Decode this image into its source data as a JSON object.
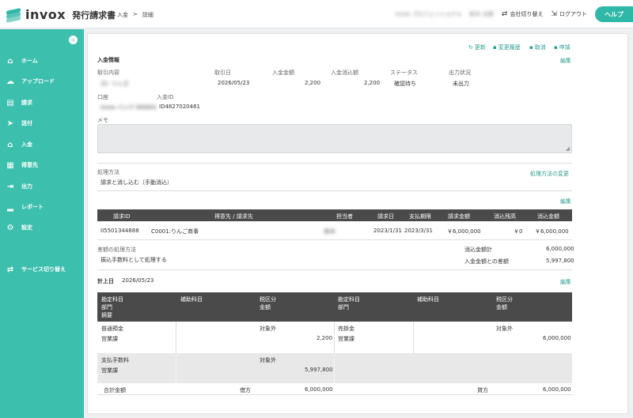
{
  "header": {
    "logo_text": "invox",
    "logo_sub": "発行請求書",
    "breadcrumb": [
      "入金",
      ">",
      "詳細"
    ],
    "company": "invox プロフェッショナル",
    "user": "鈴木 太郎",
    "switch_company": "会社切り替え",
    "logout": "ログアウト",
    "help": "ヘルプ"
  },
  "sidebar": {
    "items": [
      {
        "label": "ホーム",
        "icon": "home-icon",
        "glyph": "⌂"
      },
      {
        "label": "アップロード",
        "icon": "cloud-upload-icon",
        "glyph": "☁"
      },
      {
        "label": "請求",
        "icon": "document-icon",
        "glyph": "▤"
      },
      {
        "label": "送付",
        "icon": "send-icon",
        "glyph": "➤"
      },
      {
        "label": "入金",
        "icon": "bank-icon",
        "glyph": "⌂"
      },
      {
        "label": "得意先",
        "icon": "building-icon",
        "glyph": "▦"
      },
      {
        "label": "出力",
        "icon": "export-icon",
        "glyph": "⇥"
      },
      {
        "label": "レポート",
        "icon": "chart-icon",
        "glyph": "▂"
      },
      {
        "label": "設定",
        "icon": "gear-icon",
        "glyph": "⚙"
      }
    ],
    "service_switch": "サービス切り替え"
  },
  "actions": {
    "refresh": "更新",
    "history": "変更履歴",
    "cancel": "取消",
    "apply": "申請",
    "edit": "編集"
  },
  "deposit": {
    "section_title": "入金情報",
    "labels": {
      "content": "取引内容",
      "date": "取引日",
      "amount": "入金金額",
      "cleared": "入金消込額",
      "status": "ステータス",
      "output": "出力状況",
      "account": "口座",
      "deposit_id": "入金ID",
      "memo": "メモ"
    },
    "values": {
      "content": "カ）リンゴ",
      "date": "2026/05/23",
      "amount": "2,200",
      "cleared": "2,200",
      "status": "確認待ち",
      "output": "未出力",
      "account": "invox バンク 000001",
      "deposit_id": "ID4827020461"
    }
  },
  "processing": {
    "label": "処理方法",
    "value": "請求と消し込む（手動消込）",
    "change_link": "処理方法の変更",
    "edit": "編集"
  },
  "invoice_table": {
    "headers": [
      "請求ID",
      "得意先 / 請求先",
      "担当者",
      "請求日",
      "支払期限",
      "請求金額",
      "消込残高",
      "消込金額"
    ],
    "row": [
      "II5501344888",
      "C0001:りんご商事",
      "鈴木",
      "2023/1/31",
      "2023/3/31",
      "￥6,000,000",
      "￥0",
      "￥6,000,000"
    ]
  },
  "difference": {
    "label": "差額の処理方法",
    "value": "振込手数料として処理する",
    "total_label": "消込金額計",
    "total_value": "6,000,000",
    "diff_label": "入金金額との差額",
    "diff_value": "5,997,800"
  },
  "journal": {
    "date_label": "計上日",
    "date_value": "2026/05/23",
    "edit": "編集",
    "headers": {
      "account": "勘定科目",
      "dept": "部門",
      "summary": "摘要",
      "sub": "補助科目",
      "tax": "税区分",
      "amount": "金額"
    },
    "rows": [
      {
        "debit_account": "普通預金",
        "debit_dept": "営業課",
        "debit_tax": "対象外",
        "debit_amount": "2,200",
        "credit_account": "売掛金",
        "credit_dept": "営業課",
        "credit_tax": "対象外",
        "credit_amount": "6,000,000"
      },
      {
        "debit_account": "支払手数料",
        "debit_dept": "営業課",
        "debit_tax": "対象外",
        "debit_amount": "5,997,800",
        "credit_account": "",
        "credit_dept": "",
        "credit_tax": "",
        "credit_amount": ""
      }
    ],
    "total_label": "合計金額",
    "debit_label": "借方",
    "debit_total": "6,000,000",
    "credit_label": "貸方",
    "credit_total": "6,000,000"
  },
  "colors": {
    "accent": "#3dbfad",
    "link": "#2a9d8f",
    "table_header": "#4a4a4a"
  }
}
